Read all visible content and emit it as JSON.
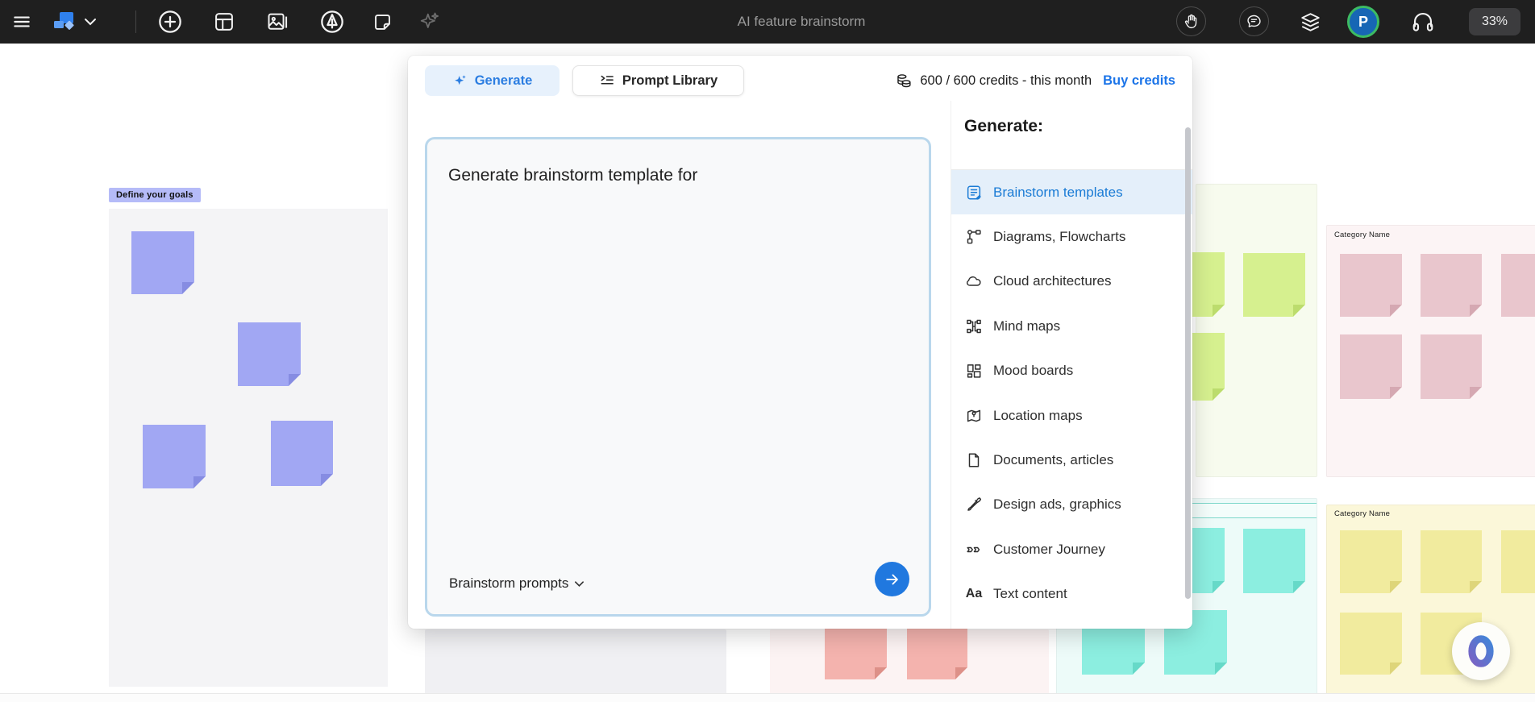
{
  "topbar": {
    "title": "AI feature brainstorm",
    "zoom_level": "33%",
    "avatar_initial": "P",
    "left_icons": [
      "menu-icon",
      "app-logo",
      "chevron-down-icon",
      "add-circle-icon",
      "template-icon",
      "image-icon",
      "pen-icon",
      "sticky-note-icon",
      "ai-sparkle-icon"
    ],
    "right_icons": [
      "raise-hand-icon",
      "comments-icon",
      "layers-icon",
      "avatar",
      "headphones-icon"
    ]
  },
  "ai_panel": {
    "tabs": [
      {
        "label": "Generate",
        "icon": "sparkle-icon",
        "active": true
      },
      {
        "label": "Prompt Library",
        "icon": "playlist-icon",
        "active": false
      }
    ],
    "credits": {
      "icon": "coins-icon",
      "text": "600 / 600 credits - this month",
      "buy_label": "Buy credits"
    },
    "prompt_input": {
      "value": "Generate brainstorm template for"
    },
    "prompts_dropdown": {
      "label": "Brainstorm prompts",
      "icon": "chevron-down-icon"
    },
    "send_button": {
      "icon": "arrow-right-icon"
    },
    "sidebar": {
      "heading": "Generate:",
      "items": [
        {
          "label": "Brainstorm templates",
          "icon": "brainstorm-doc-icon",
          "active": true
        },
        {
          "label": "Diagrams, Flowcharts",
          "icon": "flowchart-icon",
          "active": false
        },
        {
          "label": "Cloud architectures",
          "icon": "cloud-icon",
          "active": false
        },
        {
          "label": "Mind maps",
          "icon": "mindmap-icon",
          "active": false
        },
        {
          "label": "Mood boards",
          "icon": "moodboard-icon",
          "active": false
        },
        {
          "label": "Location maps",
          "icon": "location-map-icon",
          "active": false
        },
        {
          "label": "Documents, articles",
          "icon": "document-icon",
          "active": false
        },
        {
          "label": "Design ads, graphics",
          "icon": "paintbrush-icon",
          "active": false
        },
        {
          "label": "Customer Journey",
          "icon": "journey-tags-icon",
          "active": false
        },
        {
          "label": "Text content",
          "icon": "text-aa-icon",
          "active": false
        }
      ]
    }
  },
  "canvas": {
    "frame_label": "Define your goals",
    "category_label": "Category Name",
    "colors": {
      "accent_blue": "#2078df",
      "buy_link_blue": "#1b74e8",
      "active_item_bg": "#e4effa",
      "tab_bg_blue": "#e7f1fc",
      "frame_label_bg": "#b5bbf8",
      "note_purple": "#a1a7f3",
      "note_green": "#d6f08f",
      "note_pink": "#e9c6cd",
      "note_teal": "#8ceee0",
      "note_yellow": "#f1eb9e",
      "note_salmon": "#f4b3ae"
    }
  }
}
